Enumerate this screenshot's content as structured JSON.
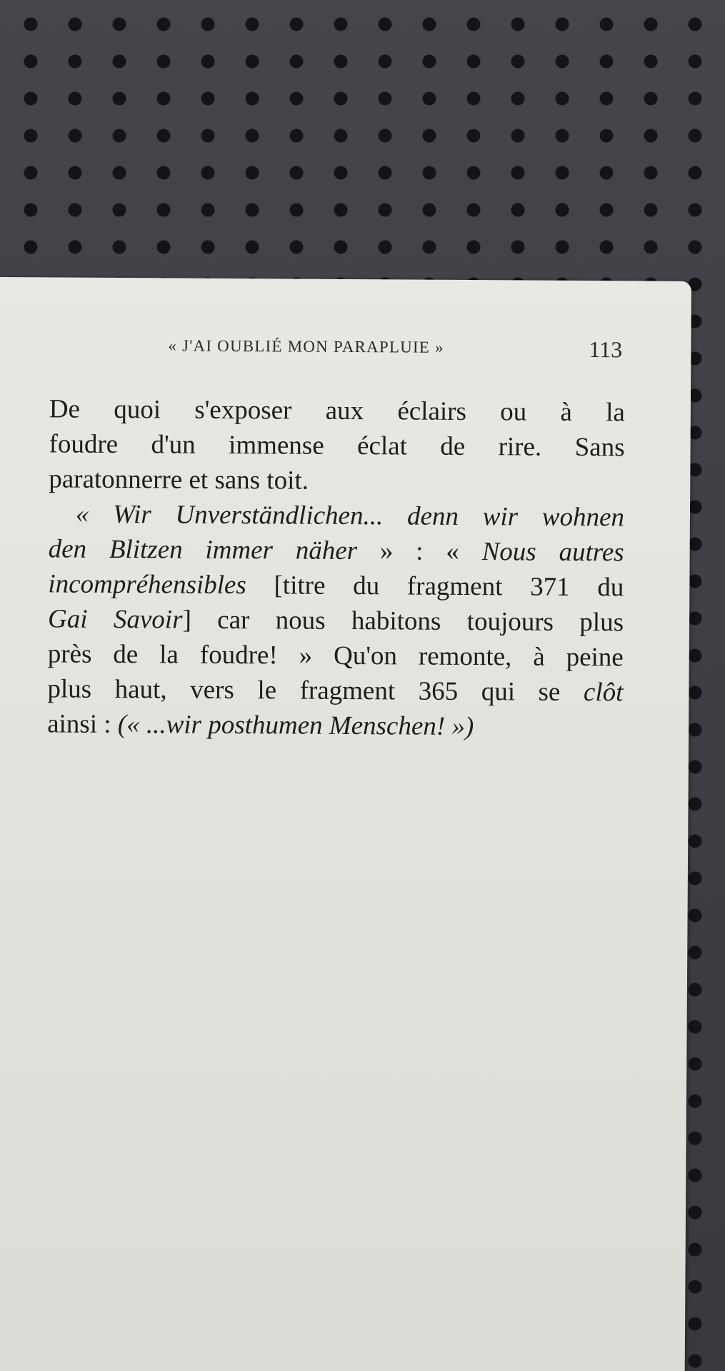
{
  "header": {
    "running_title": "« J'AI OUBLIÉ MON PARAPLUIE »",
    "page_number": "113"
  },
  "body": {
    "lines": [
      [
        "De quoi s'exposer aux éclairs ou à la"
      ],
      [
        "foudre d'un immense éclat de rire. Sans"
      ],
      [
        "paratonnerre et sans toit."
      ],
      [
        "« Wir Unverständlichen... denn wir wohnen"
      ],
      [
        "den Blitzen immer näher",
        " » : « ",
        "Nous autres"
      ],
      [
        "incompréhensibles",
        " [titre du fragment 371 du"
      ],
      [
        "Gai Savoir",
        "] car nous habitons toujours plus"
      ],
      [
        "près de la foudre! » Qu'on remonte, à peine"
      ],
      [
        "plus haut, vers le fragment 365 qui se ",
        "clôt"
      ],
      [
        "ainsi : ",
        "(« ...wir posthumen Menschen! »)"
      ]
    ]
  }
}
